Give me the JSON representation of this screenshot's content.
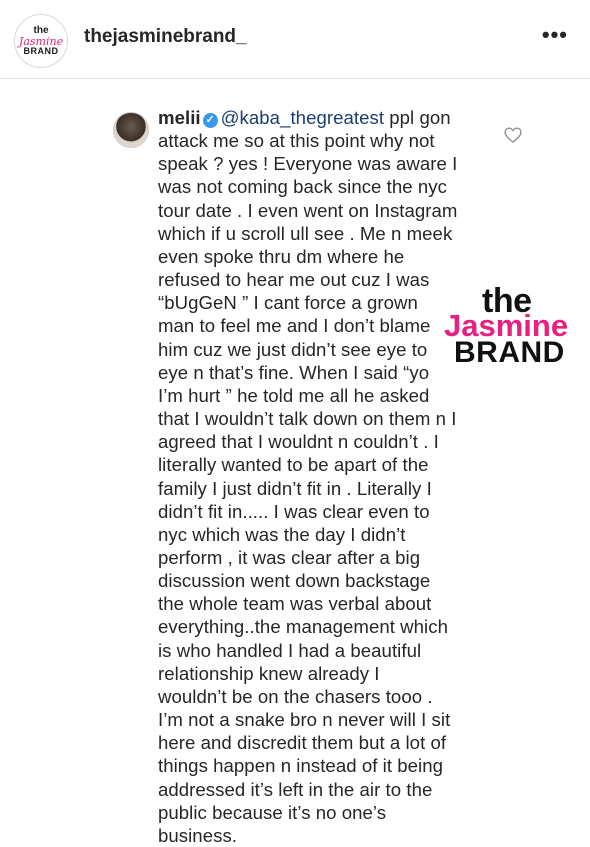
{
  "header": {
    "avatar_logo": {
      "the": "the",
      "jasmine": "Jasmine",
      "brand": "BRAND"
    },
    "username": "thejasminebrand_",
    "more_icon": "more-horizontal-icon"
  },
  "comment": {
    "username": "melii",
    "verified_icon": "verified-badge-icon",
    "mention": "@kaba_thegreatest",
    "first_line_rest": " ppl gon",
    "lines": [
      "attack me so at this point why not",
      "speak ? yes ! Everyone was aware I",
      "was not coming back since the nyc",
      "tour date . I even went on Instagram",
      "which if u scroll ull see . Me n meek",
      "even spoke thru dm  where he",
      "refused to hear me out cuz I was",
      "“bUgGeN ” I cant force a grown",
      "man to feel me and I don’t blame",
      "him cuz we just didn’t see eye to",
      "eye n that’s fine. When I said “yo",
      "I’m hurt ” he told me all he asked",
      "that I wouldn’t talk down on them n I",
      "agreed that I wouldnt n couldn’t . I",
      "literally wanted to be apart of the",
      "family I just didn’t fit in . Literally I",
      "didn’t fit in..... I was clear even to",
      "nyc which was the day I didn’t",
      "perform , it was clear after a big",
      "discussion went down backstage",
      "the whole team was verbal about",
      "everything..the management which",
      "is who handled I had a beautiful",
      "relationship knew already I",
      "wouldn’t be on the chasers tooo .",
      "I’m not a snake bro  n never will I sit",
      "here and discredit them but a lot of",
      "things happen n instead of it being",
      "addressed it’s left in the air to the",
      "public because it’s no one’s",
      "business."
    ],
    "like_icon": "heart-outline-icon"
  },
  "watermark": {
    "the": "the",
    "jasmine": "Jasmine",
    "brand": "BRAND"
  }
}
